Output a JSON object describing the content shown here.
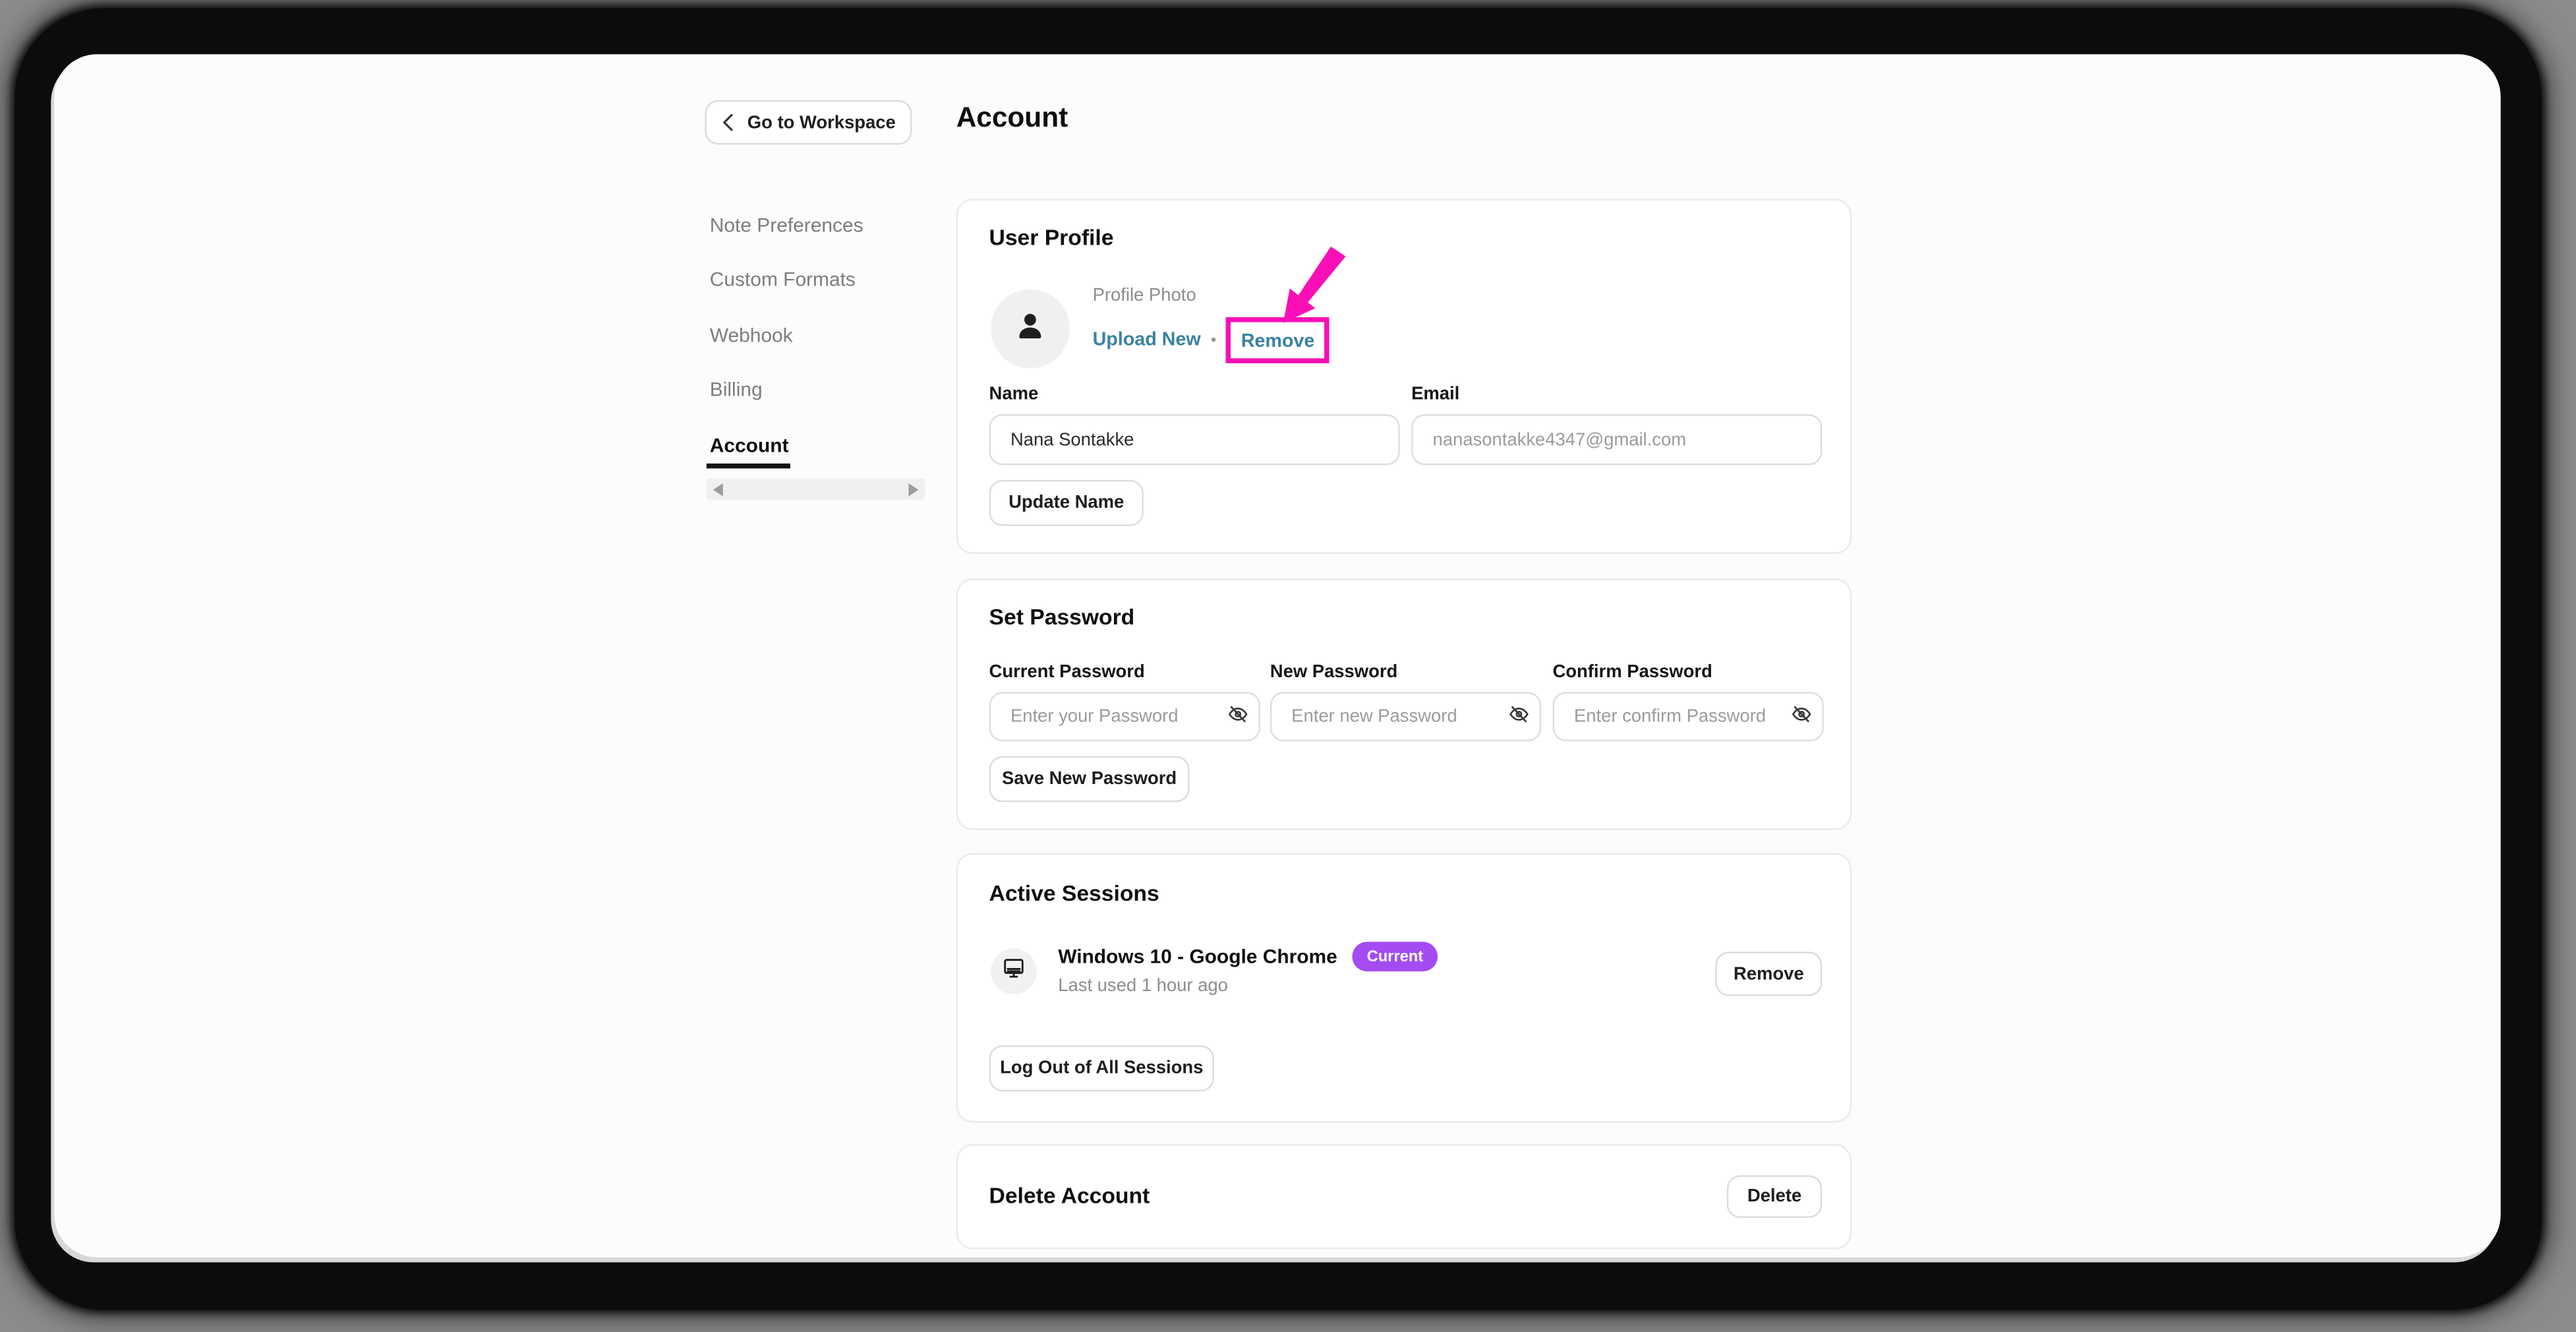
{
  "header": {
    "back_button_label": "Go to Workspace",
    "title": "Account"
  },
  "sidebar": {
    "items": [
      {
        "label": "Note Preferences",
        "active": false
      },
      {
        "label": "Custom Formats",
        "active": false
      },
      {
        "label": "Webhook",
        "active": false
      },
      {
        "label": "Billing",
        "active": false
      },
      {
        "label": "Account",
        "active": true
      }
    ]
  },
  "profile_card": {
    "title": "User Profile",
    "photo_label": "Profile Photo",
    "upload_link": "Upload New",
    "link_separator": "•",
    "remove_link": "Remove",
    "name_label": "Name",
    "name_value": "Nana Sontakke",
    "email_label": "Email",
    "email_value": "nanasontakke4347@gmail.com",
    "update_button": "Update Name"
  },
  "password_card": {
    "title": "Set Password",
    "fields": [
      {
        "label": "Current Password",
        "placeholder": "Enter your Password"
      },
      {
        "label": "New Password",
        "placeholder": "Enter new Password"
      },
      {
        "label": "Confirm Password",
        "placeholder": "Enter confirm Password"
      }
    ],
    "save_button": "Save New Password"
  },
  "sessions_card": {
    "title": "Active Sessions",
    "session": {
      "device": "Windows 10 - Google Chrome",
      "badge": "Current",
      "last_used": "Last used 1 hour ago",
      "remove_button": "Remove"
    },
    "logout_button": "Log Out of All Sessions"
  },
  "delete_card": {
    "title": "Delete Account",
    "delete_button": "Delete"
  },
  "colors": {
    "link_teal": "#3A82A1",
    "badge_purple": "#A44BF2",
    "annotation_magenta": "#F90FB5",
    "frame_black": "#0C0C0C",
    "background_gray": "#8B8B8B"
  }
}
